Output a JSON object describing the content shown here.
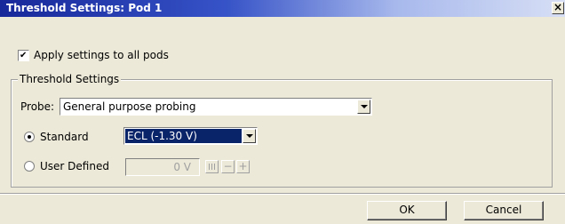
{
  "window": {
    "title": "Threshold Settings: Pod 1",
    "close_label": "×"
  },
  "apply_all": {
    "label": "Apply settings to all pods",
    "checked": true
  },
  "threshold_group": {
    "legend": "Threshold Settings",
    "probe": {
      "label": "Probe:",
      "value": "General purpose probing"
    },
    "standard": {
      "label": "Standard",
      "selected": true,
      "value": "ECL (-1.30 V)"
    },
    "user_defined": {
      "label": "User Defined",
      "selected": false,
      "value": "0 V"
    }
  },
  "buttons": {
    "ok": "OK",
    "cancel": "Cancel"
  }
}
